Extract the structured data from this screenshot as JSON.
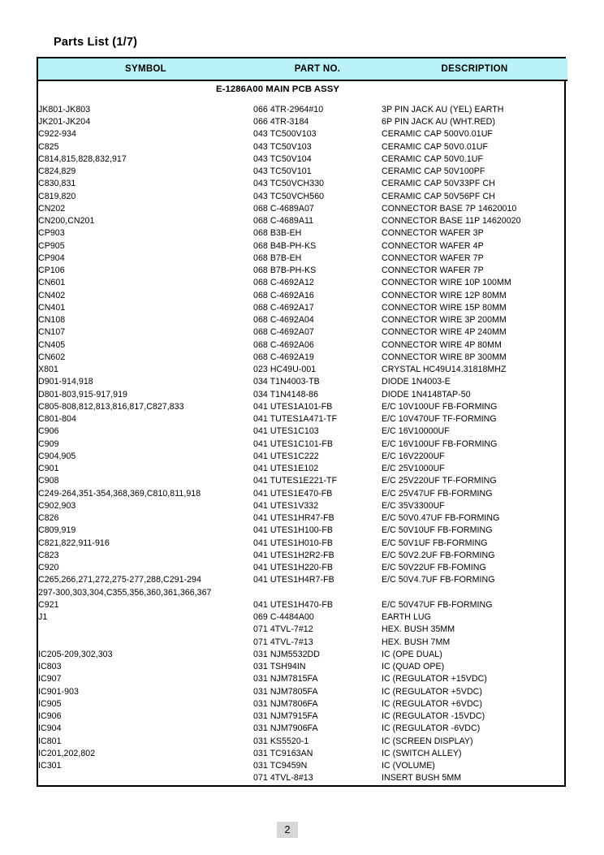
{
  "document": {
    "title": "Parts List (1/7)",
    "page_number": "2",
    "section_heading": "E-1286A00 MAIN PCB ASSY",
    "header_bg": "#b9f2f7",
    "page_num_bg": "#d7d7d7"
  },
  "table": {
    "columns": [
      "SYMBOL",
      "PART NO.",
      "DESCRIPTION"
    ],
    "rows": [
      {
        "symbol": "JK801-JK803",
        "part": "066 4TR-2964#10",
        "description": "3P PIN JACK AU (YEL) EARTH"
      },
      {
        "symbol": "JK201-JK204",
        "part": "066 4TR-3184",
        "description": "6P PIN JACK AU (WHT.RED)"
      },
      {
        "symbol": "C922-934",
        "part": "043 TC500V103",
        "description": "CERAMIC CAP 500V0.01UF"
      },
      {
        "symbol": "C825",
        "part": "043 TC50V103",
        "description": "CERAMIC CAP 50V0.01UF"
      },
      {
        "symbol": "C814,815,828,832,917",
        "part": "043 TC50V104",
        "description": "CERAMIC CAP 50V0.1UF"
      },
      {
        "symbol": "C824,829",
        "part": "043 TC50V101",
        "description": "CERAMIC CAP 50V100PF"
      },
      {
        "symbol": "C830,831",
        "part": "043 TC50VCH330",
        "description": "CERAMIC CAP 50V33PF CH"
      },
      {
        "symbol": "C819,820",
        "part": "043 TC50VCH560",
        "description": "CERAMIC CAP 50V56PF CH"
      },
      {
        "symbol": "CN202",
        "part": "068 C-4689A07",
        "description": "CONNECTOR BASE  7P 14620010"
      },
      {
        "symbol": "CN200,CN201",
        "part": "068 C-4689A11",
        "description": "CONNECTOR BASE 11P 14620020"
      },
      {
        "symbol": "CP903",
        "part": "068 B3B-EH",
        "description": "CONNECTOR WAFER 3P"
      },
      {
        "symbol": "CP905",
        "part": "068 B4B-PH-KS",
        "description": "CONNECTOR WAFER 4P"
      },
      {
        "symbol": "CP904",
        "part": "068 B7B-EH",
        "description": "CONNECTOR WAFER 7P"
      },
      {
        "symbol": "CP106",
        "part": "068 B7B-PH-KS",
        "description": "CONNECTOR WAFER 7P"
      },
      {
        "symbol": "CN601",
        "part": "068 C-4692A12",
        "description": "CONNECTOR WIRE 10P 100MM"
      },
      {
        "symbol": "CN402",
        "part": "068 C-4692A16",
        "description": "CONNECTOR WIRE 12P 80MM"
      },
      {
        "symbol": "CN401",
        "part": "068 C-4692A17",
        "description": "CONNECTOR WIRE 15P 80MM"
      },
      {
        "symbol": "CN108",
        "part": "068 C-4692A04",
        "description": "CONNECTOR WIRE 3P 200MM"
      },
      {
        "symbol": "CN107",
        "part": "068 C-4692A07",
        "description": "CONNECTOR WIRE 4P 240MM"
      },
      {
        "symbol": "CN405",
        "part": "068 C-4692A06",
        "description": "CONNECTOR WIRE 4P 80MM"
      },
      {
        "symbol": "CN602",
        "part": "068 C-4692A19",
        "description": "CONNECTOR WIRE 8P 300MM"
      },
      {
        "symbol": "X801",
        "part": "023 HC49U-001",
        "description": "CRYSTAL HC49U14.31818MHZ"
      },
      {
        "symbol": "D901-914,918",
        "part": "034 T1N4003-TB",
        "description": "DIODE 1N4003-E"
      },
      {
        "symbol": "D801-803,915-917,919",
        "part": "034 T1N4148-86",
        "description": "DIODE 1N4148TAP-50"
      },
      {
        "symbol": "C805-808,812,813,816,817,C827,833",
        "part": "041 UTES1A101-FB",
        "description": "E/C 10V100UF FB-FORMING"
      },
      {
        "symbol": "C801-804",
        "part": "041 TUTES1A471-TF",
        "description": "E/C 10V470UF TF-FORMING"
      },
      {
        "symbol": "C906",
        "part": "041 UTES1C103",
        "description": "E/C 16V10000UF"
      },
      {
        "symbol": "C909",
        "part": "041 UTES1C101-FB",
        "description": "E/C 16V100UF FB-FORMING"
      },
      {
        "symbol": "C904,905",
        "part": "041 UTES1C222",
        "description": "E/C 16V2200UF"
      },
      {
        "symbol": "C901",
        "part": "041 UTES1E102",
        "description": "E/C 25V1000UF"
      },
      {
        "symbol": "C908",
        "part": "041 TUTES1E221-TF",
        "description": "E/C 25V220UF TF-FORMING"
      },
      {
        "symbol": "C249-264,351-354,368,369,C810,811,918",
        "part": "041 UTES1E470-FB",
        "description": "E/C 25V47UF FB-FORMING"
      },
      {
        "symbol": "C902,903",
        "part": "041 UTES1V332",
        "description": "E/C 35V3300UF"
      },
      {
        "symbol": "C826",
        "part": "041 UTES1HR47-FB",
        "description": "E/C 50V0.47UF FB-FORMING"
      },
      {
        "symbol": "C809,919",
        "part": "041 UTES1H100-FB",
        "description": "E/C 50V10UF FB-FORMING"
      },
      {
        "symbol": "C821,822,911-916",
        "part": "041 UTES1H010-FB",
        "description": "E/C 50V1UF FB-FORMING"
      },
      {
        "symbol": "C823",
        "part": "041 UTES1H2R2-FB",
        "description": "E/C 50V2.2UF FB-FORMING"
      },
      {
        "symbol": "C920",
        "part": "041 UTES1H220-FB",
        "description": "E/C 50V22UF FB-FOMING"
      },
      {
        "symbol": "C265,266,271,272,275-277,288,C291-294",
        "part": "041 UTES1H4R7-FB",
        "description": "E/C 50V4.7UF FB-FORMING"
      },
      {
        "symbol": "297-300,303,304,C355,356,360,361,366,367",
        "part": "",
        "description": ""
      },
      {
        "symbol": "C921",
        "part": "041 UTES1H470-FB",
        "description": "E/C 50V47UF FB-FORMING"
      },
      {
        "symbol": "J1",
        "part": "069 C-4484A00",
        "description": "EARTH LUG"
      },
      {
        "symbol": "",
        "part": "071 4TVL-7#12",
        "description": "HEX. BUSH 35MM"
      },
      {
        "symbol": "",
        "part": "071 4TVL-7#13",
        "description": "HEX. BUSH 7MM"
      },
      {
        "symbol": "IC205-209,302,303",
        "part": "031 NJM5532DD",
        "description": "IC (OPE DUAL)"
      },
      {
        "symbol": "IC803",
        "part": "031 TSH94IN",
        "description": "IC (QUAD OPE)"
      },
      {
        "symbol": "IC907",
        "part": "031 NJM7815FA",
        "description": "IC (REGULATOR +15VDC)"
      },
      {
        "symbol": "IC901-903",
        "part": "031 NJM7805FA",
        "description": "IC (REGULATOR +5VDC)"
      },
      {
        "symbol": "IC905",
        "part": "031 NJM7806FA",
        "description": "IC (REGULATOR +6VDC)"
      },
      {
        "symbol": "IC906",
        "part": "031 NJM7915FA",
        "description": "IC (REGULATOR -15VDC)"
      },
      {
        "symbol": "IC904",
        "part": "031 NJM7906FA",
        "description": "IC (REGULATOR -6VDC)"
      },
      {
        "symbol": "IC801",
        "part": "031 KS5520-1",
        "description": "IC (SCREEN DISPLAY)"
      },
      {
        "symbol": "IC201,202,802",
        "part": "031 TC9163AN",
        "description": "IC (SWITCH ALLEY)"
      },
      {
        "symbol": "IC301",
        "part": "031 TC9459N",
        "description": "IC (VOLUME)"
      },
      {
        "symbol": "",
        "part": "071 4TVL-8#13",
        "description": "INSERT BUSH 5MM"
      }
    ]
  }
}
